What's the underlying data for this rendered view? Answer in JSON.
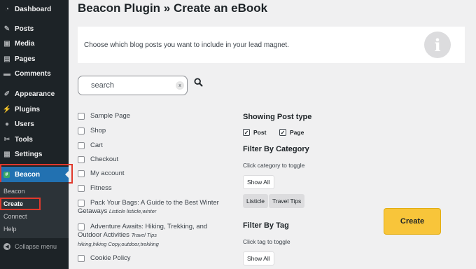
{
  "sidebar": {
    "items": [
      {
        "label": "Dashboard",
        "icon": "dashboard-icon"
      },
      {
        "label": "Posts",
        "icon": "pushpin-icon"
      },
      {
        "label": "Media",
        "icon": "media-icon"
      },
      {
        "label": "Pages",
        "icon": "pages-icon"
      },
      {
        "label": "Comments",
        "icon": "comment-icon"
      },
      {
        "label": "Appearance",
        "icon": "brush-icon"
      },
      {
        "label": "Plugins",
        "icon": "plugin-icon"
      },
      {
        "label": "Users",
        "icon": "user-icon"
      },
      {
        "label": "Tools",
        "icon": "wrench-icon"
      },
      {
        "label": "Settings",
        "icon": "settings-icon"
      }
    ],
    "active": {
      "label": "Beacon",
      "icon": "beacon-icon"
    },
    "submenu": [
      "Beacon",
      "Create",
      "Connect",
      "Help"
    ],
    "collapse_label": "Collapse menu"
  },
  "header": {
    "title": "Beacon Plugin » Create an eBook"
  },
  "notice": {
    "text": "Choose which blog posts you want to include in your lead magnet."
  },
  "search": {
    "placeholder": "search",
    "clear": "x"
  },
  "posts": [
    {
      "title": "Sample Page"
    },
    {
      "title": "Shop"
    },
    {
      "title": "Cart"
    },
    {
      "title": "Checkout"
    },
    {
      "title": "My account"
    },
    {
      "title": "Fitness"
    },
    {
      "title": "Pack Your Bags: A Guide to the Best Winter",
      "title2": "Getaways",
      "tags": "Listicle listicle,winter"
    },
    {
      "title": "Adventure Awaits: Hiking, Trekking, and",
      "title2": "Outdoor Activities",
      "tags": "Travel Tips",
      "tags2": "hiking,hiking Copy,outdoor,trekking"
    },
    {
      "title": "Cookie Policy"
    }
  ],
  "filters": {
    "post_type_heading": "Showing Post type",
    "post_types": [
      "Post",
      "Page"
    ],
    "category_heading": "Filter By Category",
    "category_hint": "Click category to toggle",
    "show_all": "Show All",
    "categories": [
      "Listicle",
      "Travel Tips"
    ],
    "tag_heading": "Filter By Tag",
    "tag_hint": "Click tag to toggle"
  },
  "create_label": "Create",
  "colors": {
    "accent": "#2271b1",
    "create": "#f8c53a",
    "highlight": "#e0392c"
  }
}
